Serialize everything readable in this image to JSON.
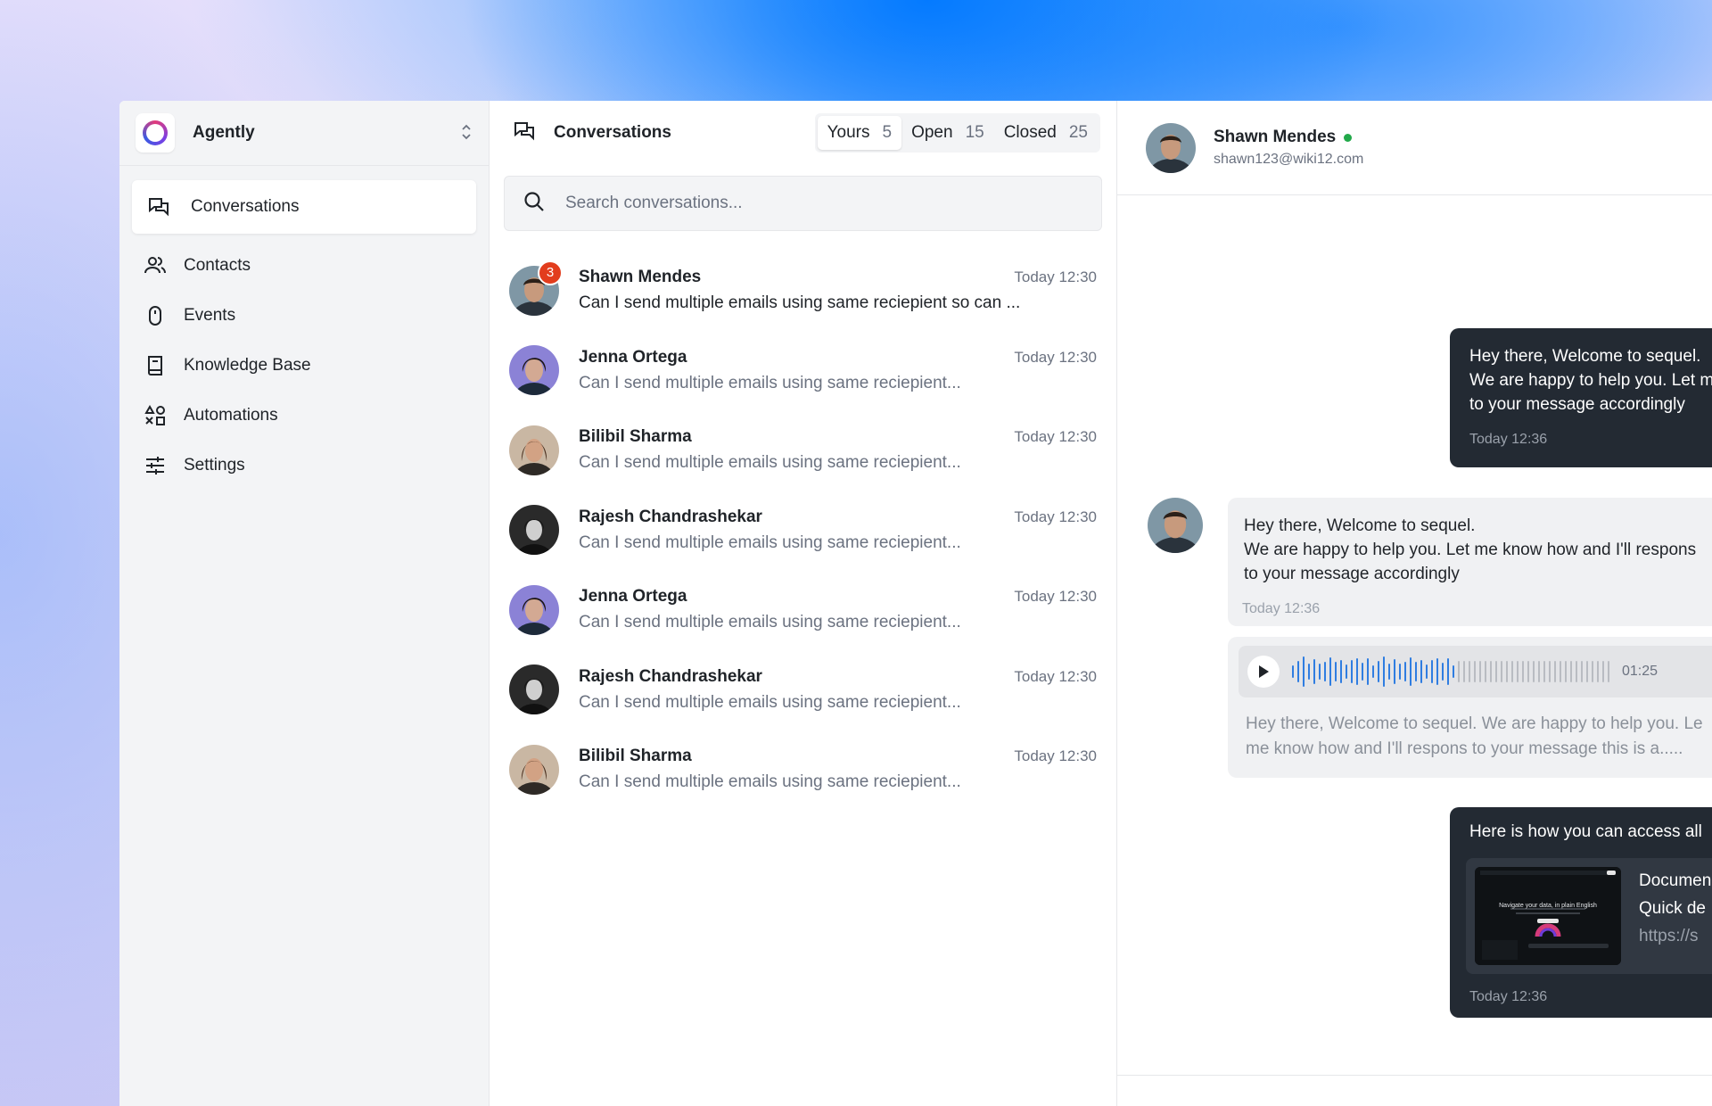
{
  "brand": {
    "name": "Agently"
  },
  "sidebar": {
    "items": [
      {
        "label": "Conversations",
        "icon": "chat-bubbles-icon",
        "active": true
      },
      {
        "label": "Contacts",
        "icon": "users-icon"
      },
      {
        "label": "Events",
        "icon": "mouse-icon"
      },
      {
        "label": "Knowledge Base",
        "icon": "book-icon"
      },
      {
        "label": "Automations",
        "icon": "shapes-icon"
      },
      {
        "label": "Settings",
        "icon": "sliders-icon"
      }
    ]
  },
  "list": {
    "title": "Conversations",
    "tabs": [
      {
        "label": "Yours",
        "count": "5",
        "active": true
      },
      {
        "label": "Open",
        "count": "15"
      },
      {
        "label": "Closed",
        "count": "25"
      }
    ],
    "search_placeholder": "Search conversations...",
    "conversations": [
      {
        "name": "Shawn Mendes",
        "time": "Today 12:30",
        "message": "Can I send multiple emails using same reciepient so can ...",
        "badge": "3",
        "unread": true
      },
      {
        "name": "Jenna Ortega",
        "time": "Today 12:30",
        "message": "Can I send multiple emails using same reciepient..."
      },
      {
        "name": "Bilibil Sharma",
        "time": "Today 12:30",
        "message": "Can I send multiple emails using same reciepient..."
      },
      {
        "name": "Rajesh Chandrashekar",
        "time": "Today 12:30",
        "message": "Can I send multiple emails using same reciepient..."
      },
      {
        "name": "Jenna Ortega",
        "time": "Today 12:30",
        "message": "Can I send multiple emails using same reciepient..."
      },
      {
        "name": "Rajesh Chandrashekar",
        "time": "Today 12:30",
        "message": "Can I send multiple emails using same reciepient..."
      },
      {
        "name": "Bilibil Sharma",
        "time": "Today 12:30",
        "message": "Can I send multiple emails using same reciepient..."
      }
    ]
  },
  "chat": {
    "contact": {
      "name": "Shawn Mendes",
      "email": "shawn123@wiki12.com",
      "status": "online"
    },
    "messages": {
      "out1": {
        "lines": [
          "Hey there, Welcome to sequel.",
          "We are happy to help you. Let m",
          "to your message accordingly"
        ],
        "time": "Today 12:36"
      },
      "in1": {
        "lines": [
          "Hey there, Welcome to sequel.",
          "We are happy to help you. Let me know how and I'll respons",
          "to your message accordingly"
        ],
        "time": "Today 12:36"
      },
      "audio": {
        "duration": "01:25",
        "progress": 0.52,
        "transcript": [
          "Hey there, Welcome to sequel. We are happy to help you. Le",
          "me know how and I'll respons to your message this is a....."
        ]
      },
      "out2": {
        "text": "Here is how you can access all",
        "doc_title": "Documen",
        "doc_sub": "Quick de",
        "doc_url": "https://s",
        "thumb_heading": "Navigate your data, in plain English",
        "time": "Today 12:36"
      }
    }
  },
  "colors": {
    "accent_dark": "#232a33",
    "online": "#22a94a",
    "badge": "#e23d1d",
    "wave_played": "#2f7de1"
  }
}
